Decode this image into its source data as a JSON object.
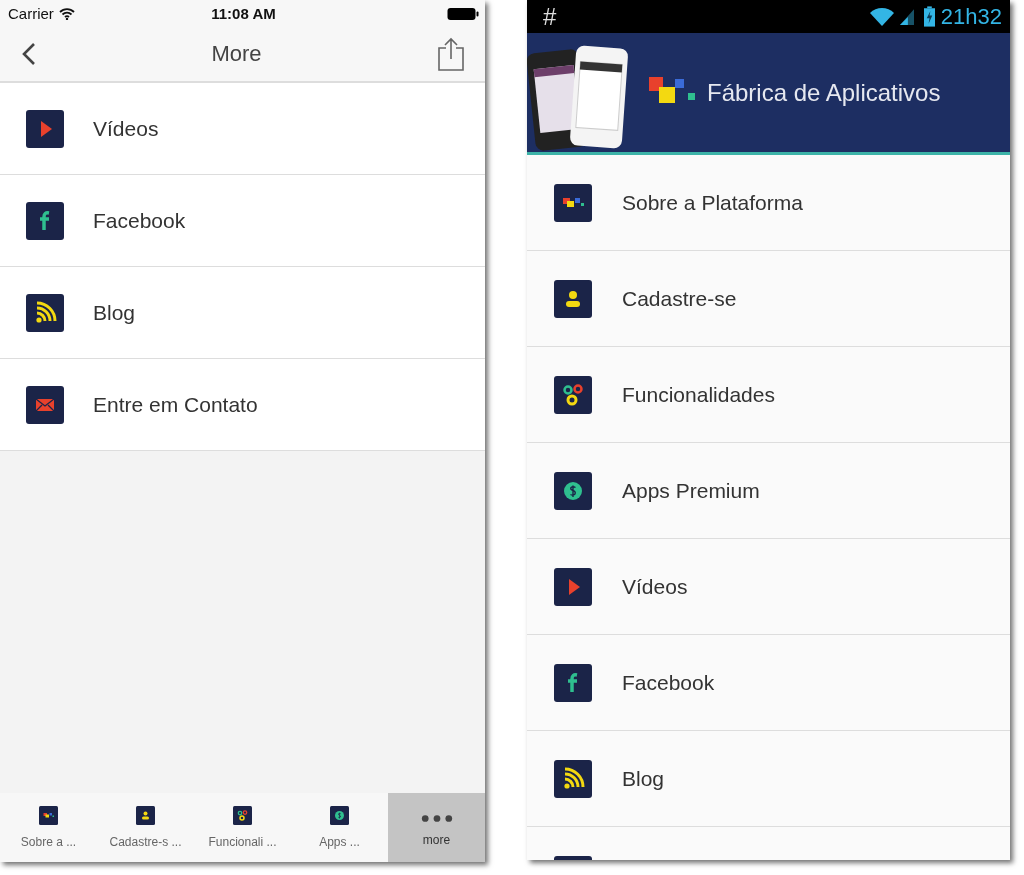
{
  "ios": {
    "status_bar": {
      "carrier": "Carrier",
      "time": "11:08 AM"
    },
    "nav": {
      "title": "More"
    },
    "items": [
      {
        "kind": "play",
        "label": "Vídeos"
      },
      {
        "kind": "facebook",
        "label": "Facebook"
      },
      {
        "kind": "rss",
        "label": "Blog"
      },
      {
        "kind": "mail",
        "label": "Entre em Contato"
      }
    ],
    "tab_bar": [
      {
        "kind": "blocks",
        "label": "Sobre a ...",
        "selected": false
      },
      {
        "kind": "person",
        "label": "Cadastre-s ...",
        "selected": false
      },
      {
        "kind": "gears",
        "label": "Funcionali ...",
        "selected": false
      },
      {
        "kind": "dollar",
        "label": "Apps ...",
        "selected": false
      },
      {
        "kind": "dots",
        "label": "more",
        "selected": true
      }
    ]
  },
  "android": {
    "status_bar": {
      "notification": "#",
      "time": "21h32"
    },
    "banner": {
      "title": "Fábrica de Aplicativos"
    },
    "items": [
      {
        "kind": "blocks",
        "label": "Sobre a Plataforma"
      },
      {
        "kind": "person",
        "label": "Cadastre-se"
      },
      {
        "kind": "gears",
        "label": "Funcionalidades"
      },
      {
        "kind": "dollar",
        "label": "Apps Premium"
      },
      {
        "kind": "play",
        "label": "Vídeos"
      },
      {
        "kind": "facebook",
        "label": "Facebook"
      },
      {
        "kind": "rss",
        "label": "Blog"
      },
      {
        "kind": "tile"
      }
    ]
  }
}
